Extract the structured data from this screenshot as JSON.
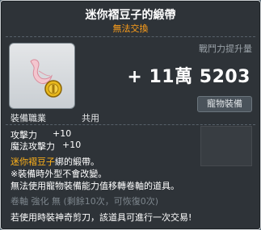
{
  "tooltip": {
    "title": "迷你褶豆子的緞帶",
    "trade_status": "無法交換",
    "power_label": "戰鬥力提升量",
    "power_value": "+ 11萬 5203",
    "pet_badge": "寵物裝備",
    "req_job_label": "裝備職業",
    "req_job_value": "共用",
    "stats": [
      {
        "label": "攻擊力",
        "value": "+10"
      },
      {
        "label": "魔法攻擊力",
        "value": "+10"
      }
    ],
    "desc_line1_highlight": "迷你褶豆子",
    "desc_line1_rest": "綁的緞帶。",
    "desc_line2": "※裝備時外型不會改變。",
    "desc_line3": "無法使用寵物裝備能力值移轉卷軸的道具。",
    "scroll_line": "卷軸  強化  無  (剩餘10次，可恢復0次)",
    "scissors_line": "若使用時裝神奇剪刀，該道具可進行一次交易!",
    "icon": "pet-ribbon-icon",
    "colors": {
      "background": "#2e3338",
      "trade_status": "#ff9f1a",
      "highlight": "#ffb21a",
      "muted": "#7d868d"
    }
  }
}
